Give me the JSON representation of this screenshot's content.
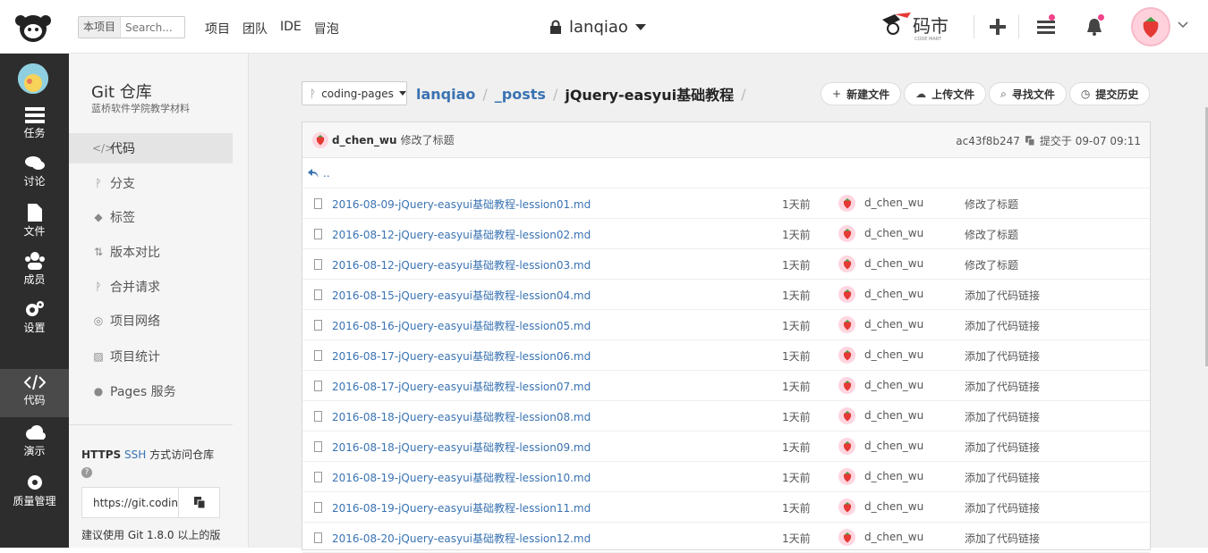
{
  "topbar": {
    "search": {
      "scope": "本项目",
      "placeholder": "Search..."
    },
    "nav": [
      "项目",
      "团队",
      "IDE",
      "冒泡"
    ],
    "project_name": "lanqiao",
    "brand_text": "码市",
    "brand_sub": "CODE MART",
    "icons": [
      "plus-icon",
      "list-icon",
      "bell-icon"
    ],
    "notification_color": "#f1428a"
  },
  "rail": {
    "items": [
      {
        "label": "任务",
        "icon": "tasks-icon"
      },
      {
        "label": "讨论",
        "icon": "chat-icon"
      },
      {
        "label": "文件",
        "icon": "file-icon"
      },
      {
        "label": "成员",
        "icon": "members-icon"
      },
      {
        "label": "设置",
        "icon": "settings-icon"
      },
      {
        "label": "代码",
        "icon": "code-icon",
        "active": true
      },
      {
        "label": "演示",
        "icon": "cloud-icon"
      },
      {
        "label": "质量管理",
        "icon": "quality-icon"
      }
    ]
  },
  "sidebar": {
    "title": "Git 仓库",
    "subtitle": "蓝桥软件学院教学材料",
    "items": [
      {
        "label": "代码",
        "icon": "code-icon",
        "active": true
      },
      {
        "label": "分支",
        "icon": "branch-icon"
      },
      {
        "label": "标签",
        "icon": "tag-icon"
      },
      {
        "label": "版本对比",
        "icon": "compare-icon"
      },
      {
        "label": "合并请求",
        "icon": "merge-icon"
      },
      {
        "label": "项目网络",
        "icon": "network-icon"
      },
      {
        "label": "项目统计",
        "icon": "stats-icon"
      },
      {
        "label": "Pages 服务",
        "icon": "globe-icon"
      }
    ],
    "access": {
      "https": "HTTPS",
      "ssh": "SSH",
      "text": "方式访问仓库"
    },
    "url_value": "https://git.coding",
    "advice": "建议使用 Git 1.8.0 以上的版"
  },
  "main": {
    "branch": "coding-pages",
    "breadcrumb": [
      "lanqiao",
      "_posts",
      "jQuery-easyui基础教程"
    ],
    "actions": [
      {
        "label": "新建文件",
        "icon": "plus-icon"
      },
      {
        "label": "上传文件",
        "icon": "upload-icon"
      },
      {
        "label": "寻找文件",
        "icon": "search-icon"
      },
      {
        "label": "提交历史",
        "icon": "history-icon"
      }
    ],
    "commit": {
      "author": "d_chen_wu",
      "message": "修改了标题",
      "hash": "ac43f8b247",
      "date": "提交于 09-07 09:11"
    },
    "parent_label": "..",
    "files": [
      {
        "name": "2016-08-09-jQuery-easyui基础教程-lession01.md",
        "time": "1天前",
        "author": "d_chen_wu",
        "message": "修改了标题"
      },
      {
        "name": "2016-08-12-jQuery-easyui基础教程-lession02.md",
        "time": "1天前",
        "author": "d_chen_wu",
        "message": "修改了标题"
      },
      {
        "name": "2016-08-12-jQuery-easyui基础教程-lession03.md",
        "time": "1天前",
        "author": "d_chen_wu",
        "message": "修改了标题"
      },
      {
        "name": "2016-08-15-jQuery-easyui基础教程-lession04.md",
        "time": "1天前",
        "author": "d_chen_wu",
        "message": "添加了代码链接"
      },
      {
        "name": "2016-08-16-jQuery-easyui基础教程-lession05.md",
        "time": "1天前",
        "author": "d_chen_wu",
        "message": "添加了代码链接"
      },
      {
        "name": "2016-08-17-jQuery-easyui基础教程-lession06.md",
        "time": "1天前",
        "author": "d_chen_wu",
        "message": "添加了代码链接"
      },
      {
        "name": "2016-08-17-jQuery-easyui基础教程-lession07.md",
        "time": "1天前",
        "author": "d_chen_wu",
        "message": "添加了代码链接"
      },
      {
        "name": "2016-08-18-jQuery-easyui基础教程-lession08.md",
        "time": "1天前",
        "author": "d_chen_wu",
        "message": "添加了代码链接"
      },
      {
        "name": "2016-08-18-jQuery-easyui基础教程-lession09.md",
        "time": "1天前",
        "author": "d_chen_wu",
        "message": "添加了代码链接"
      },
      {
        "name": "2016-08-19-jQuery-easyui基础教程-lession10.md",
        "time": "1天前",
        "author": "d_chen_wu",
        "message": "添加了代码链接"
      },
      {
        "name": "2016-08-19-jQuery-easyui基础教程-lession11.md",
        "time": "1天前",
        "author": "d_chen_wu",
        "message": "添加了代码链接"
      },
      {
        "name": "2016-08-20-jQuery-easyui基础教程-lession12.md",
        "time": "1天前",
        "author": "d_chen_wu",
        "message": "添加了代码链接"
      }
    ]
  },
  "colors": {
    "link": "#3a73b2",
    "rail_bg": "#2d2d2d",
    "rail_active": "#4a4a4a"
  }
}
